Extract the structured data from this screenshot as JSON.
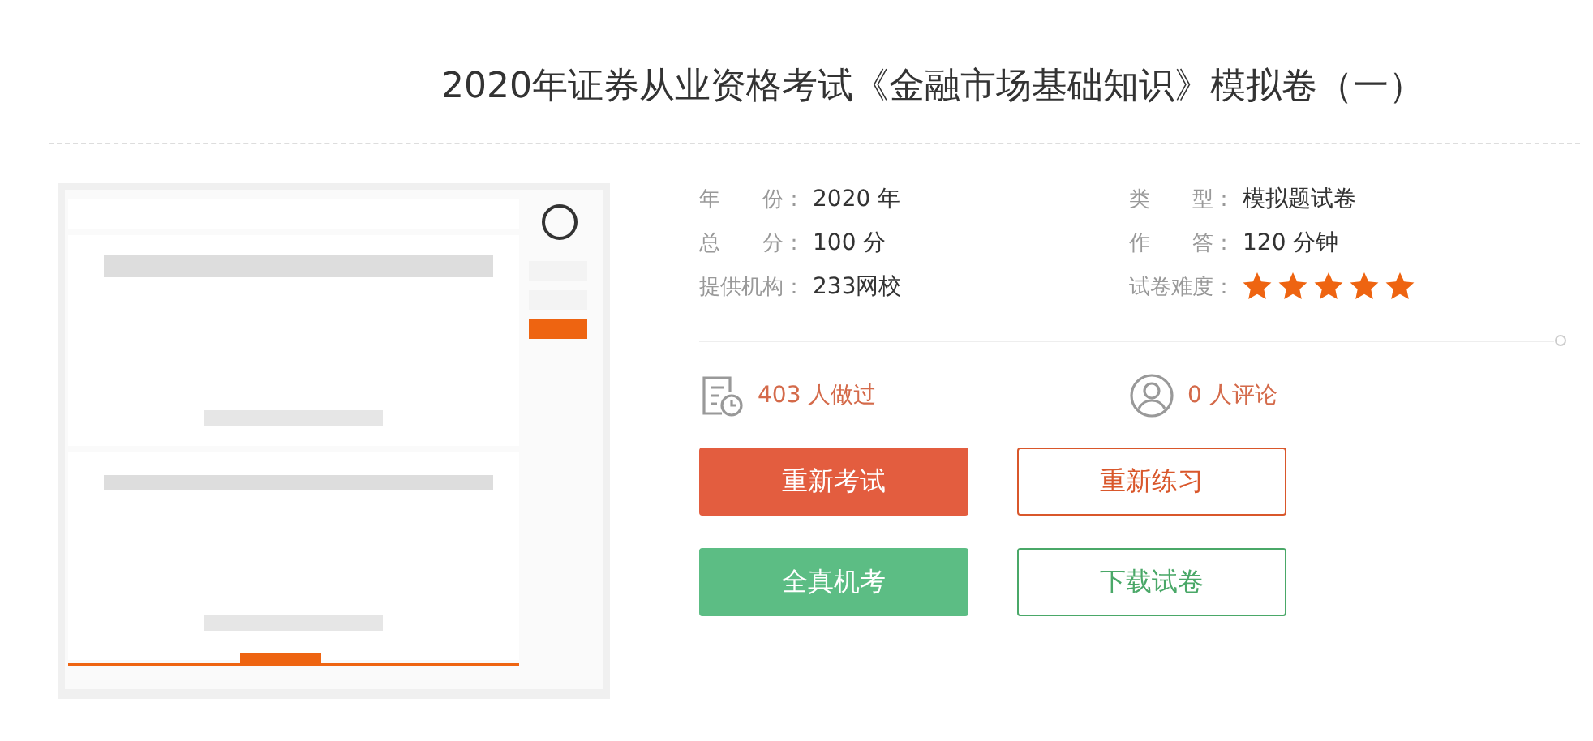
{
  "title": "2020年证券从业资格考试《金融市场基础知识》模拟卷（一）",
  "info": [
    {
      "label": "年　　份：",
      "value": "2020 年"
    },
    {
      "label": "类　　型：",
      "value": "模拟题试卷"
    },
    {
      "label": "总　　分：",
      "value": "100 分"
    },
    {
      "label": "作　　答：",
      "value": "120 分钟"
    },
    {
      "label": "提供机构：",
      "value": "233网校"
    },
    {
      "label": "试卷难度：",
      "stars": 5
    }
  ],
  "stats": [
    {
      "kind": "done",
      "text": "403 人做过"
    },
    {
      "kind": "comment",
      "text": "0 人评论"
    }
  ],
  "buttons": [
    {
      "label": "重新考试",
      "kind": "solid",
      "color": "#e35d3f"
    },
    {
      "label": "重新练习",
      "kind": "outline",
      "color": "#d9572b"
    },
    {
      "label": "全真机考",
      "kind": "solid",
      "color": "#5cbd84"
    },
    {
      "label": "下载试卷",
      "kind": "outline",
      "color": "#4aa868"
    }
  ]
}
